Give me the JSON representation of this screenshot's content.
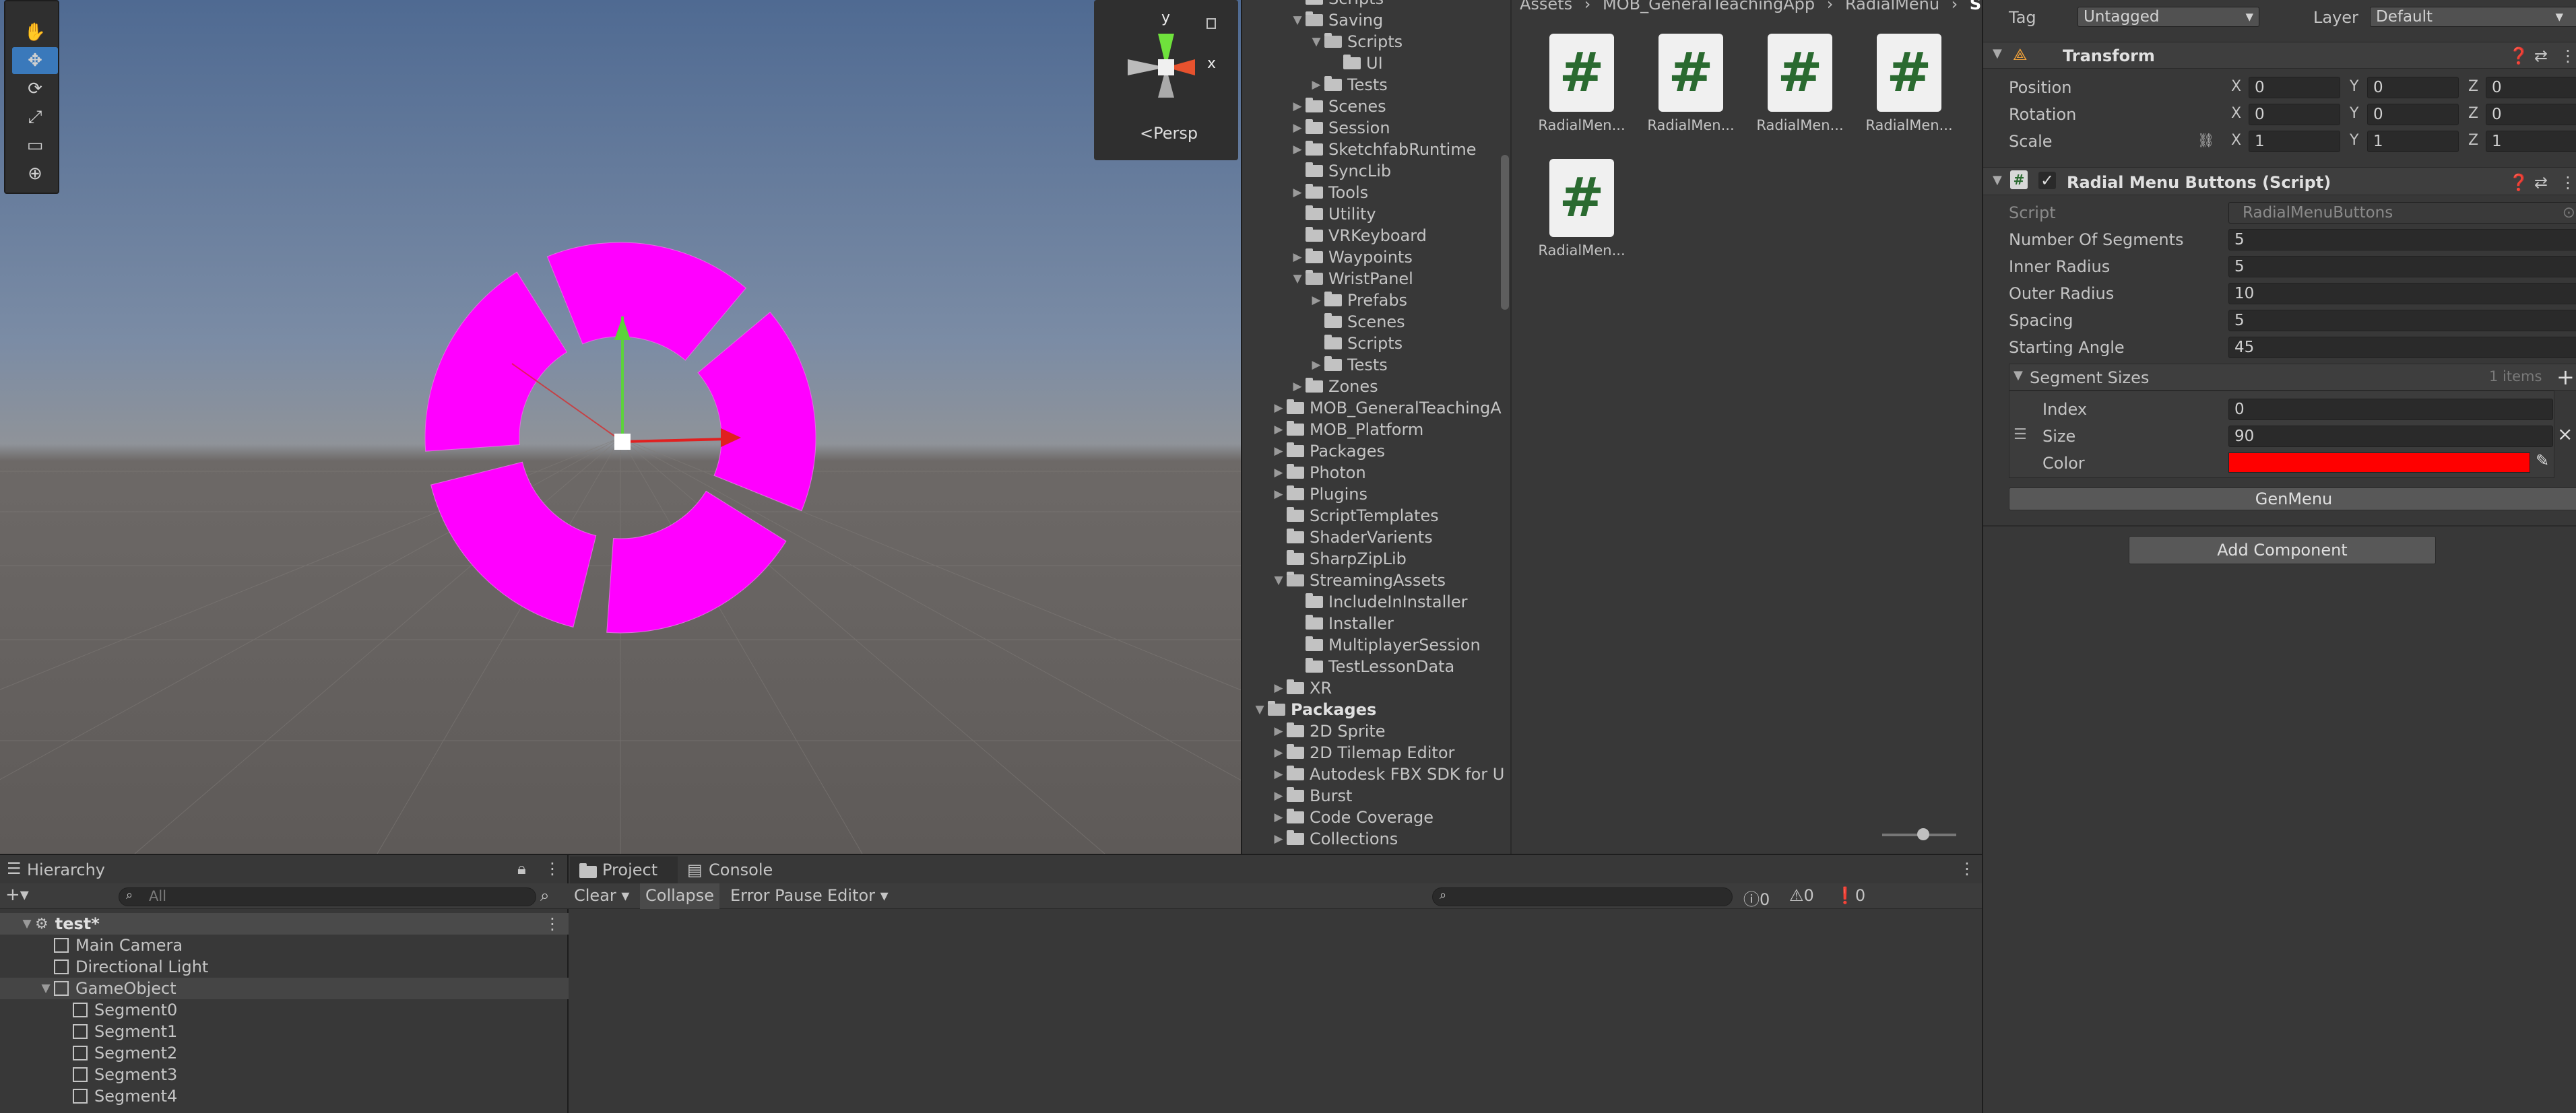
{
  "toolbar_tools": [
    {
      "name": "hand-tool-icon",
      "glyph": "✋"
    },
    {
      "name": "move-tool-icon",
      "glyph": "✥"
    },
    {
      "name": "rotate-tool-icon",
      "glyph": "⟳"
    },
    {
      "name": "scale-tool-icon",
      "glyph": "⤢"
    },
    {
      "name": "rect-tool-icon",
      "glyph": "▭"
    },
    {
      "name": "transform-tool-icon",
      "glyph": "⊕"
    }
  ],
  "gizmo": {
    "y": "y",
    "x": "x",
    "persp": "Persp"
  },
  "project_tree": [
    {
      "indent": 2,
      "arrow": "",
      "label": "Scripts",
      "open": false
    },
    {
      "indent": 2,
      "arrow": "▼",
      "label": "Saving",
      "open": true
    },
    {
      "indent": 3,
      "arrow": "▼",
      "label": "Scripts",
      "open": true
    },
    {
      "indent": 4,
      "arrow": "",
      "label": "UI",
      "open": false
    },
    {
      "indent": 3,
      "arrow": "▶",
      "label": "Tests",
      "open": false
    },
    {
      "indent": 2,
      "arrow": "▶",
      "label": "Scenes",
      "open": false
    },
    {
      "indent": 2,
      "arrow": "▶",
      "label": "Session",
      "open": false
    },
    {
      "indent": 2,
      "arrow": "▶",
      "label": "SketchfabRuntime",
      "open": false
    },
    {
      "indent": 2,
      "arrow": "",
      "label": "SyncLib",
      "open": false
    },
    {
      "indent": 2,
      "arrow": "▶",
      "label": "Tools",
      "open": false
    },
    {
      "indent": 2,
      "arrow": "",
      "label": "Utility",
      "open": false
    },
    {
      "indent": 2,
      "arrow": "",
      "label": "VRKeyboard",
      "open": false
    },
    {
      "indent": 2,
      "arrow": "▶",
      "label": "Waypoints",
      "open": false
    },
    {
      "indent": 2,
      "arrow": "▼",
      "label": "WristPanel",
      "open": true
    },
    {
      "indent": 3,
      "arrow": "▶",
      "label": "Prefabs",
      "open": false
    },
    {
      "indent": 3,
      "arrow": "",
      "label": "Scenes",
      "open": false
    },
    {
      "indent": 3,
      "arrow": "",
      "label": "Scripts",
      "open": false
    },
    {
      "indent": 3,
      "arrow": "▶",
      "label": "Tests",
      "open": false
    },
    {
      "indent": 2,
      "arrow": "▶",
      "label": "Zones",
      "open": false
    },
    {
      "indent": 1,
      "arrow": "▶",
      "label": "MOB_GeneralTeachingA",
      "open": false
    },
    {
      "indent": 1,
      "arrow": "▶",
      "label": "MOB_Platform",
      "open": false
    },
    {
      "indent": 1,
      "arrow": "▶",
      "label": "Packages",
      "open": false
    },
    {
      "indent": 1,
      "arrow": "▶",
      "label": "Photon",
      "open": false
    },
    {
      "indent": 1,
      "arrow": "▶",
      "label": "Plugins",
      "open": false
    },
    {
      "indent": 1,
      "arrow": "",
      "label": "ScriptTemplates",
      "open": false
    },
    {
      "indent": 1,
      "arrow": "",
      "label": "ShaderVarients",
      "open": false
    },
    {
      "indent": 1,
      "arrow": "",
      "label": "SharpZipLib",
      "open": false
    },
    {
      "indent": 1,
      "arrow": "▼",
      "label": "StreamingAssets",
      "open": true
    },
    {
      "indent": 2,
      "arrow": "",
      "label": "IncludeInInstaller",
      "open": false
    },
    {
      "indent": 2,
      "arrow": "",
      "label": "Installer",
      "open": false
    },
    {
      "indent": 2,
      "arrow": "",
      "label": "MultiplayerSession",
      "open": false
    },
    {
      "indent": 2,
      "arrow": "",
      "label": "TestLessonData",
      "open": false
    },
    {
      "indent": 1,
      "arrow": "▶",
      "label": "XR",
      "open": false
    },
    {
      "indent": 0,
      "arrow": "▼",
      "label": "Packages",
      "open": true,
      "bold": true
    },
    {
      "indent": 1,
      "arrow": "▶",
      "label": "2D Sprite",
      "open": false
    },
    {
      "indent": 1,
      "arrow": "▶",
      "label": "2D Tilemap Editor",
      "open": false
    },
    {
      "indent": 1,
      "arrow": "▶",
      "label": "Autodesk FBX SDK for U",
      "open": false
    },
    {
      "indent": 1,
      "arrow": "▶",
      "label": "Burst",
      "open": false
    },
    {
      "indent": 1,
      "arrow": "▶",
      "label": "Code Coverage",
      "open": false
    },
    {
      "indent": 1,
      "arrow": "▶",
      "label": "Collections",
      "open": false
    }
  ],
  "breadcrumb": [
    "Assets",
    "MOB_GeneralTeachingApp",
    "RadialMenu",
    "Scripts"
  ],
  "assets": [
    "RadialMen...",
    "RadialMen...",
    "RadialMen...",
    "RadialMen...",
    "RadialMen..."
  ],
  "asset_glyph": "#",
  "hierarchy": {
    "tab": "Hierarchy",
    "search_placeholder": "All",
    "add_label": "+▾",
    "items": [
      {
        "label": "test*",
        "indent": 0,
        "arrow": "▼",
        "scene": true
      },
      {
        "label": "Main Camera",
        "indent": 1,
        "arrow": ""
      },
      {
        "label": "Directional Light",
        "indent": 1,
        "arrow": ""
      },
      {
        "label": "GameObject",
        "indent": 1,
        "arrow": "▼"
      },
      {
        "label": "Segment0",
        "indent": 2,
        "arrow": ""
      },
      {
        "label": "Segment1",
        "indent": 2,
        "arrow": ""
      },
      {
        "label": "Segment2",
        "indent": 2,
        "arrow": ""
      },
      {
        "label": "Segment3",
        "indent": 2,
        "arrow": ""
      },
      {
        "label": "Segment4",
        "indent": 2,
        "arrow": ""
      }
    ]
  },
  "console": {
    "tab_project": "Project",
    "tab_console": "Console",
    "clear": "Clear",
    "collapse": "Collapse",
    "error_pause": "Error Pause",
    "editor": "Editor",
    "info_count": "0",
    "warn_count": "0",
    "error_count": "0"
  },
  "inspector": {
    "tag_label": "Tag",
    "tag_value": "Untagged",
    "layer_label": "Layer",
    "layer_value": "Default",
    "transform_title": "Transform",
    "position_label": "Position",
    "rotation_label": "Rotation",
    "scale_label": "Scale",
    "position": [
      "0",
      "0",
      "0"
    ],
    "rotation": [
      "0",
      "0",
      "0"
    ],
    "scale": [
      "1",
      "1",
      "1"
    ],
    "axes": [
      "X",
      "Y",
      "Z"
    ],
    "component_title": "Radial Menu Buttons (Script)",
    "script_label": "Script",
    "script_value": "RadialMenuButtons",
    "props": [
      {
        "label": "Number Of Segments",
        "value": "5"
      },
      {
        "label": "Inner Radius",
        "value": "5"
      },
      {
        "label": "Outer Radius",
        "value": "10"
      },
      {
        "label": "Spacing",
        "value": "5"
      },
      {
        "label": "Starting Angle",
        "value": "45"
      }
    ],
    "segment_sizes_label": "Segment Sizes",
    "segment_count": "1 items",
    "index_label": "Index",
    "index_value": "0",
    "size_label": "Size",
    "size_value": "90",
    "color_label": "Color",
    "color_value": "#ff0000",
    "gen_button": "GenMenu",
    "add_component": "Add Component"
  },
  "colors": {
    "segment": "#ff00ff",
    "accent": "#3a79bb"
  }
}
